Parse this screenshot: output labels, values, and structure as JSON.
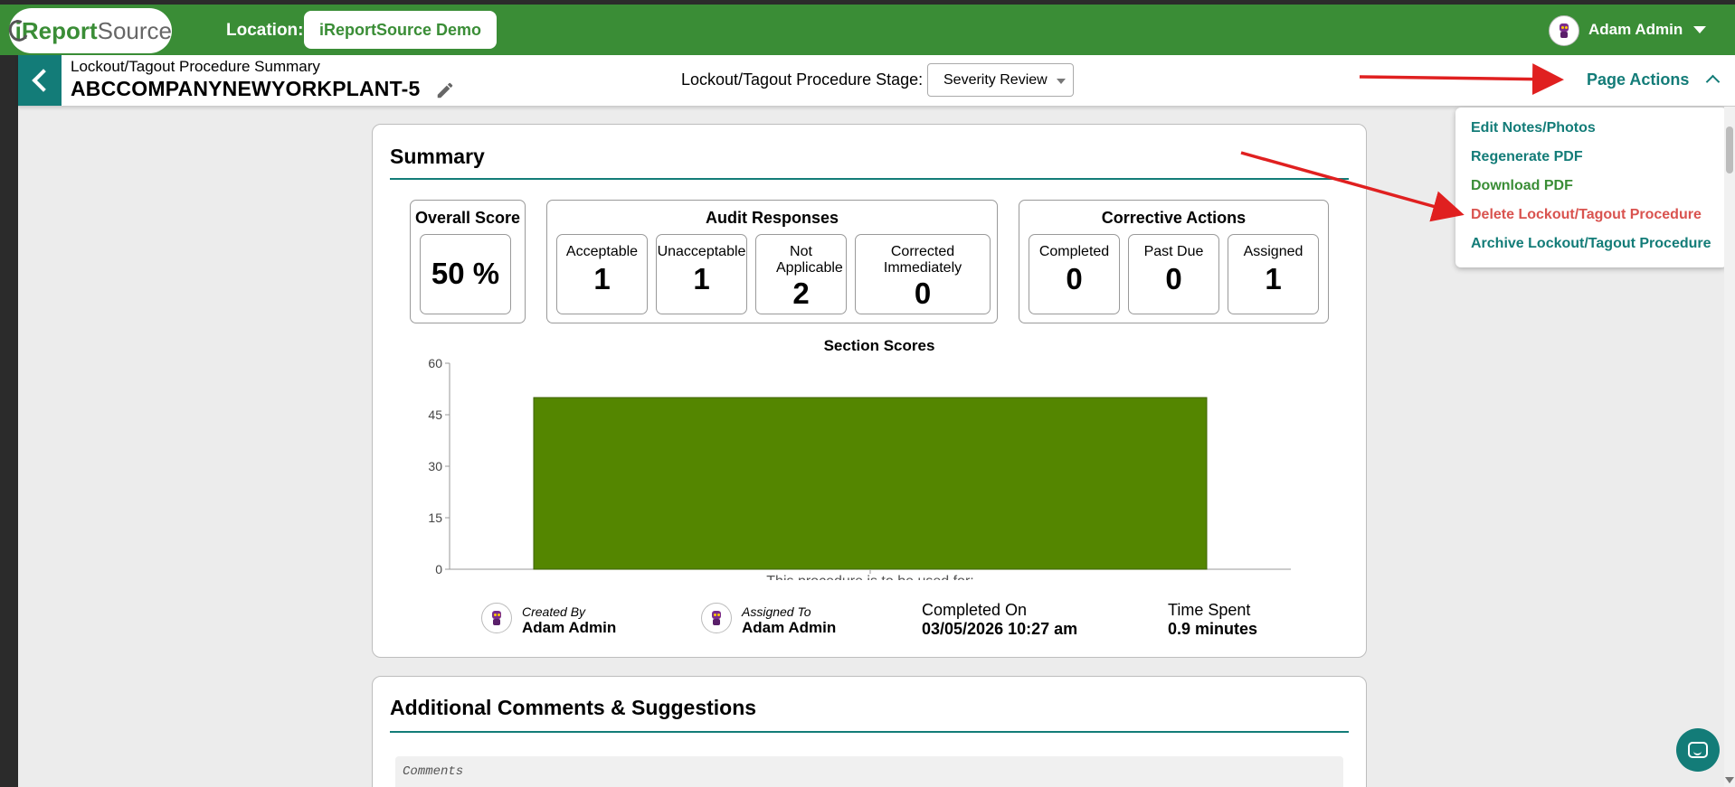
{
  "topbar": {
    "logo_i": "i",
    "logo_report": "Report",
    "logo_source": "Source",
    "location_label": "Location:",
    "location_value": "iReportSource Demo",
    "user_name": "Adam Admin"
  },
  "header": {
    "subtitle": "Lockout/Tagout Procedure Summary",
    "title": "ABCCOMPANYNEWYORKPLANT-5",
    "stage_label": "Lockout/Tagout Procedure Stage:",
    "stage_value": "Severity Review",
    "page_actions": "Page Actions"
  },
  "page_actions_menu": {
    "items": [
      {
        "label": "Edit Notes/Photos"
      },
      {
        "label": "Regenerate PDF"
      },
      {
        "label": "Download PDF"
      },
      {
        "label": "Delete Lockout/Tagout Procedure"
      },
      {
        "label": "Archive Lockout/Tagout Procedure"
      }
    ]
  },
  "summary": {
    "title": "Summary",
    "overall_score": {
      "label": "Overall Score",
      "value": "50 %"
    },
    "audit_responses": {
      "title": "Audit Responses",
      "metrics": [
        {
          "label": "Acceptable",
          "value": "1"
        },
        {
          "label": "Unacceptable",
          "value": "1"
        },
        {
          "label": "Not Applicable",
          "value": "2"
        },
        {
          "label": "Corrected Immediately",
          "value": "0"
        }
      ]
    },
    "corrective_actions": {
      "title": "Corrective Actions",
      "metrics": [
        {
          "label": "Completed",
          "value": "0"
        },
        {
          "label": "Past Due",
          "value": "0"
        },
        {
          "label": "Assigned",
          "value": "1"
        }
      ]
    },
    "created_by": {
      "label": "Created By",
      "value": "Adam Admin"
    },
    "assigned_to": {
      "label": "Assigned To",
      "value": "Adam Admin"
    },
    "completed_on": {
      "label": "Completed On",
      "value": "03/05/2026 10:27 am"
    },
    "time_spent": {
      "label": "Time Spent",
      "value": "0.9 minutes"
    }
  },
  "chart_data": {
    "type": "bar",
    "title": "Section Scores",
    "categories": [
      "This procedure is to be used for:"
    ],
    "values": [
      50
    ],
    "ylim": [
      0,
      60
    ],
    "yticks": [
      0,
      15,
      30,
      45,
      60
    ],
    "xlabel": "",
    "ylabel": "",
    "bar_color": "#548600",
    "grid": false
  },
  "comments": {
    "title": "Additional Comments & Suggestions",
    "placeholder": "Comments"
  },
  "colors": {
    "brand_green": "#3a8d36",
    "teal": "#137c78",
    "danger": "#d9534f"
  }
}
